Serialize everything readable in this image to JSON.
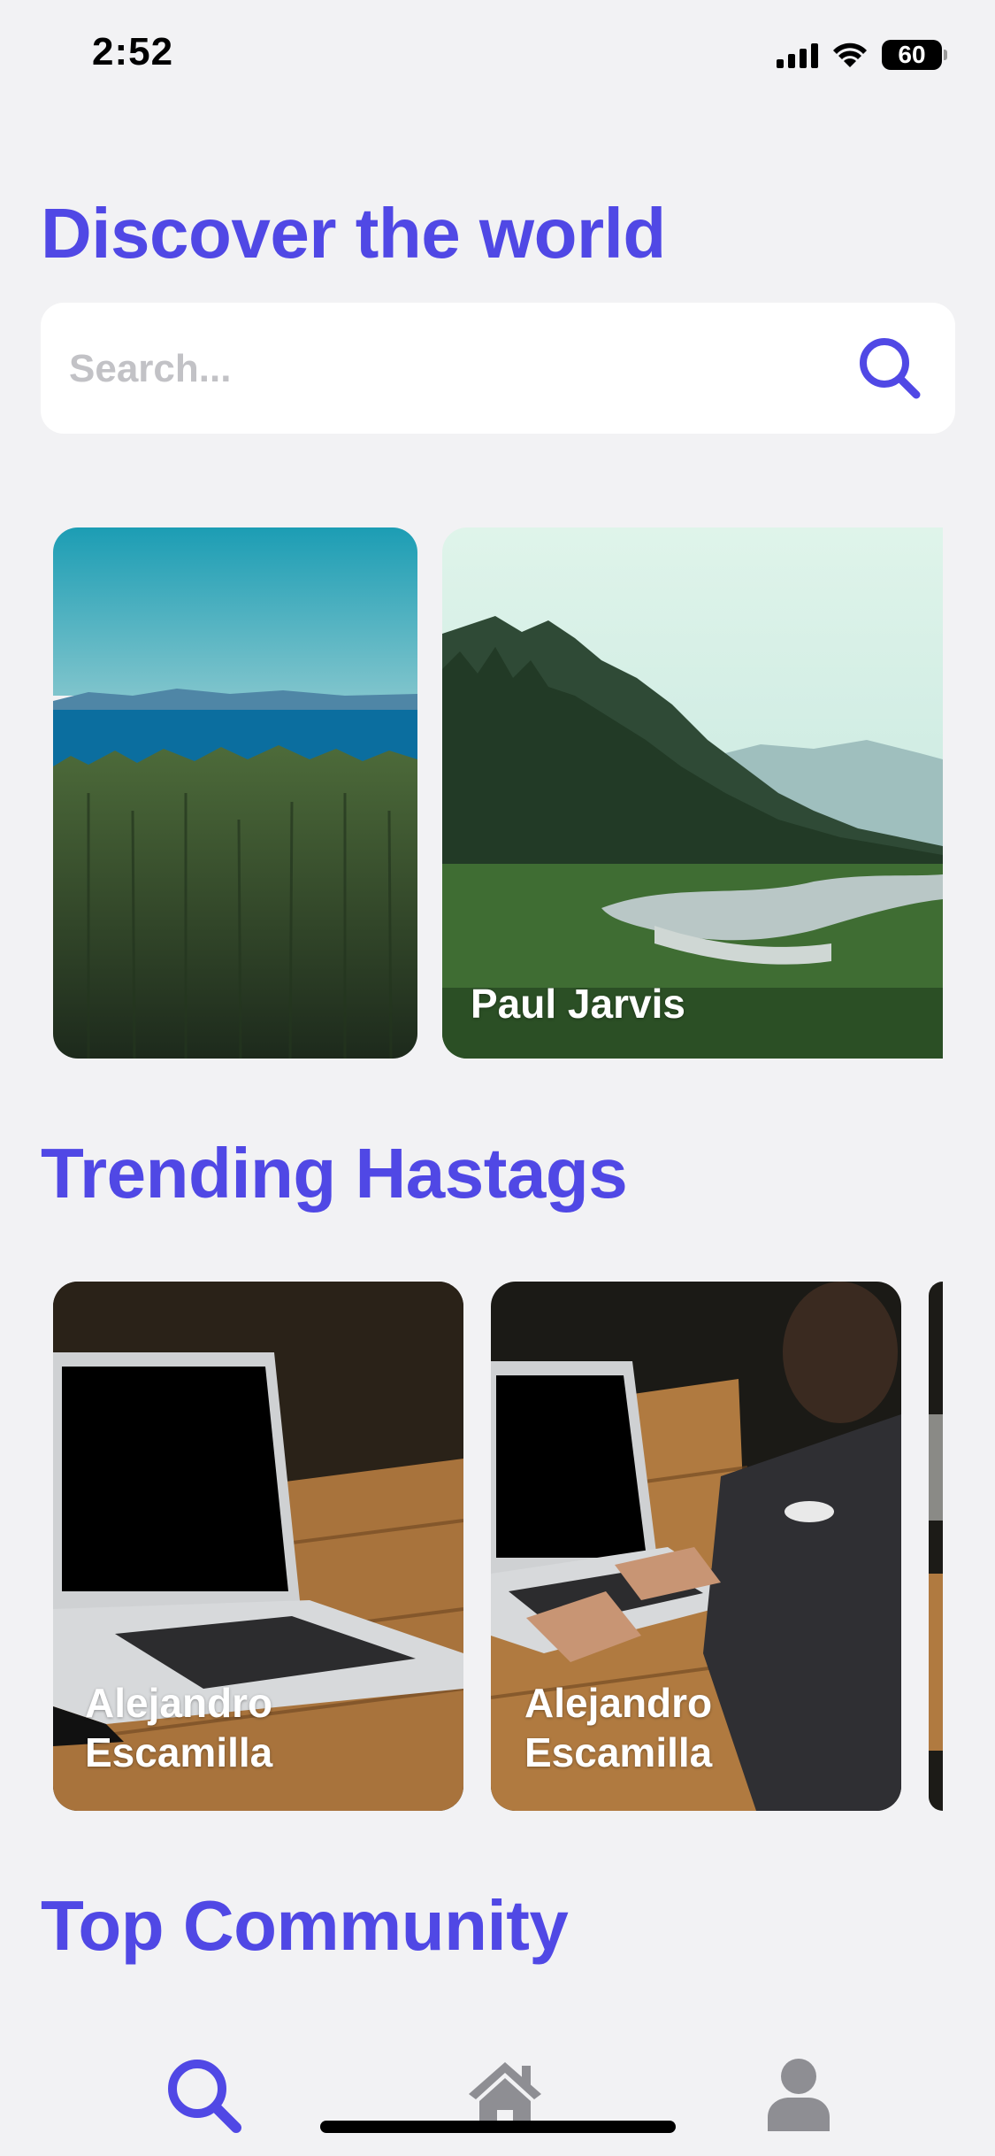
{
  "status_bar": {
    "time": "2:52",
    "battery": "60"
  },
  "header": {
    "title": "Discover the world"
  },
  "search": {
    "placeholder": "Search..."
  },
  "discover": {
    "cards": [
      {
        "label": ""
      },
      {
        "label": "Paul Jarvis"
      }
    ]
  },
  "trending": {
    "title": "Trending Hastags",
    "cards": [
      {
        "label_line1": "Alejandro",
        "label_line2": "Escamilla"
      },
      {
        "label_line1": "Alejandro",
        "label_line2": "Escamilla"
      }
    ]
  },
  "community": {
    "title": "Top Community"
  },
  "tabs": [
    {
      "icon": "search-icon",
      "active": true
    },
    {
      "icon": "home-icon",
      "active": false
    },
    {
      "icon": "profile-icon",
      "active": false
    }
  ],
  "colors": {
    "accent": "#5048e5",
    "inactive": "#8e8e93",
    "background": "#f2f2f4"
  }
}
